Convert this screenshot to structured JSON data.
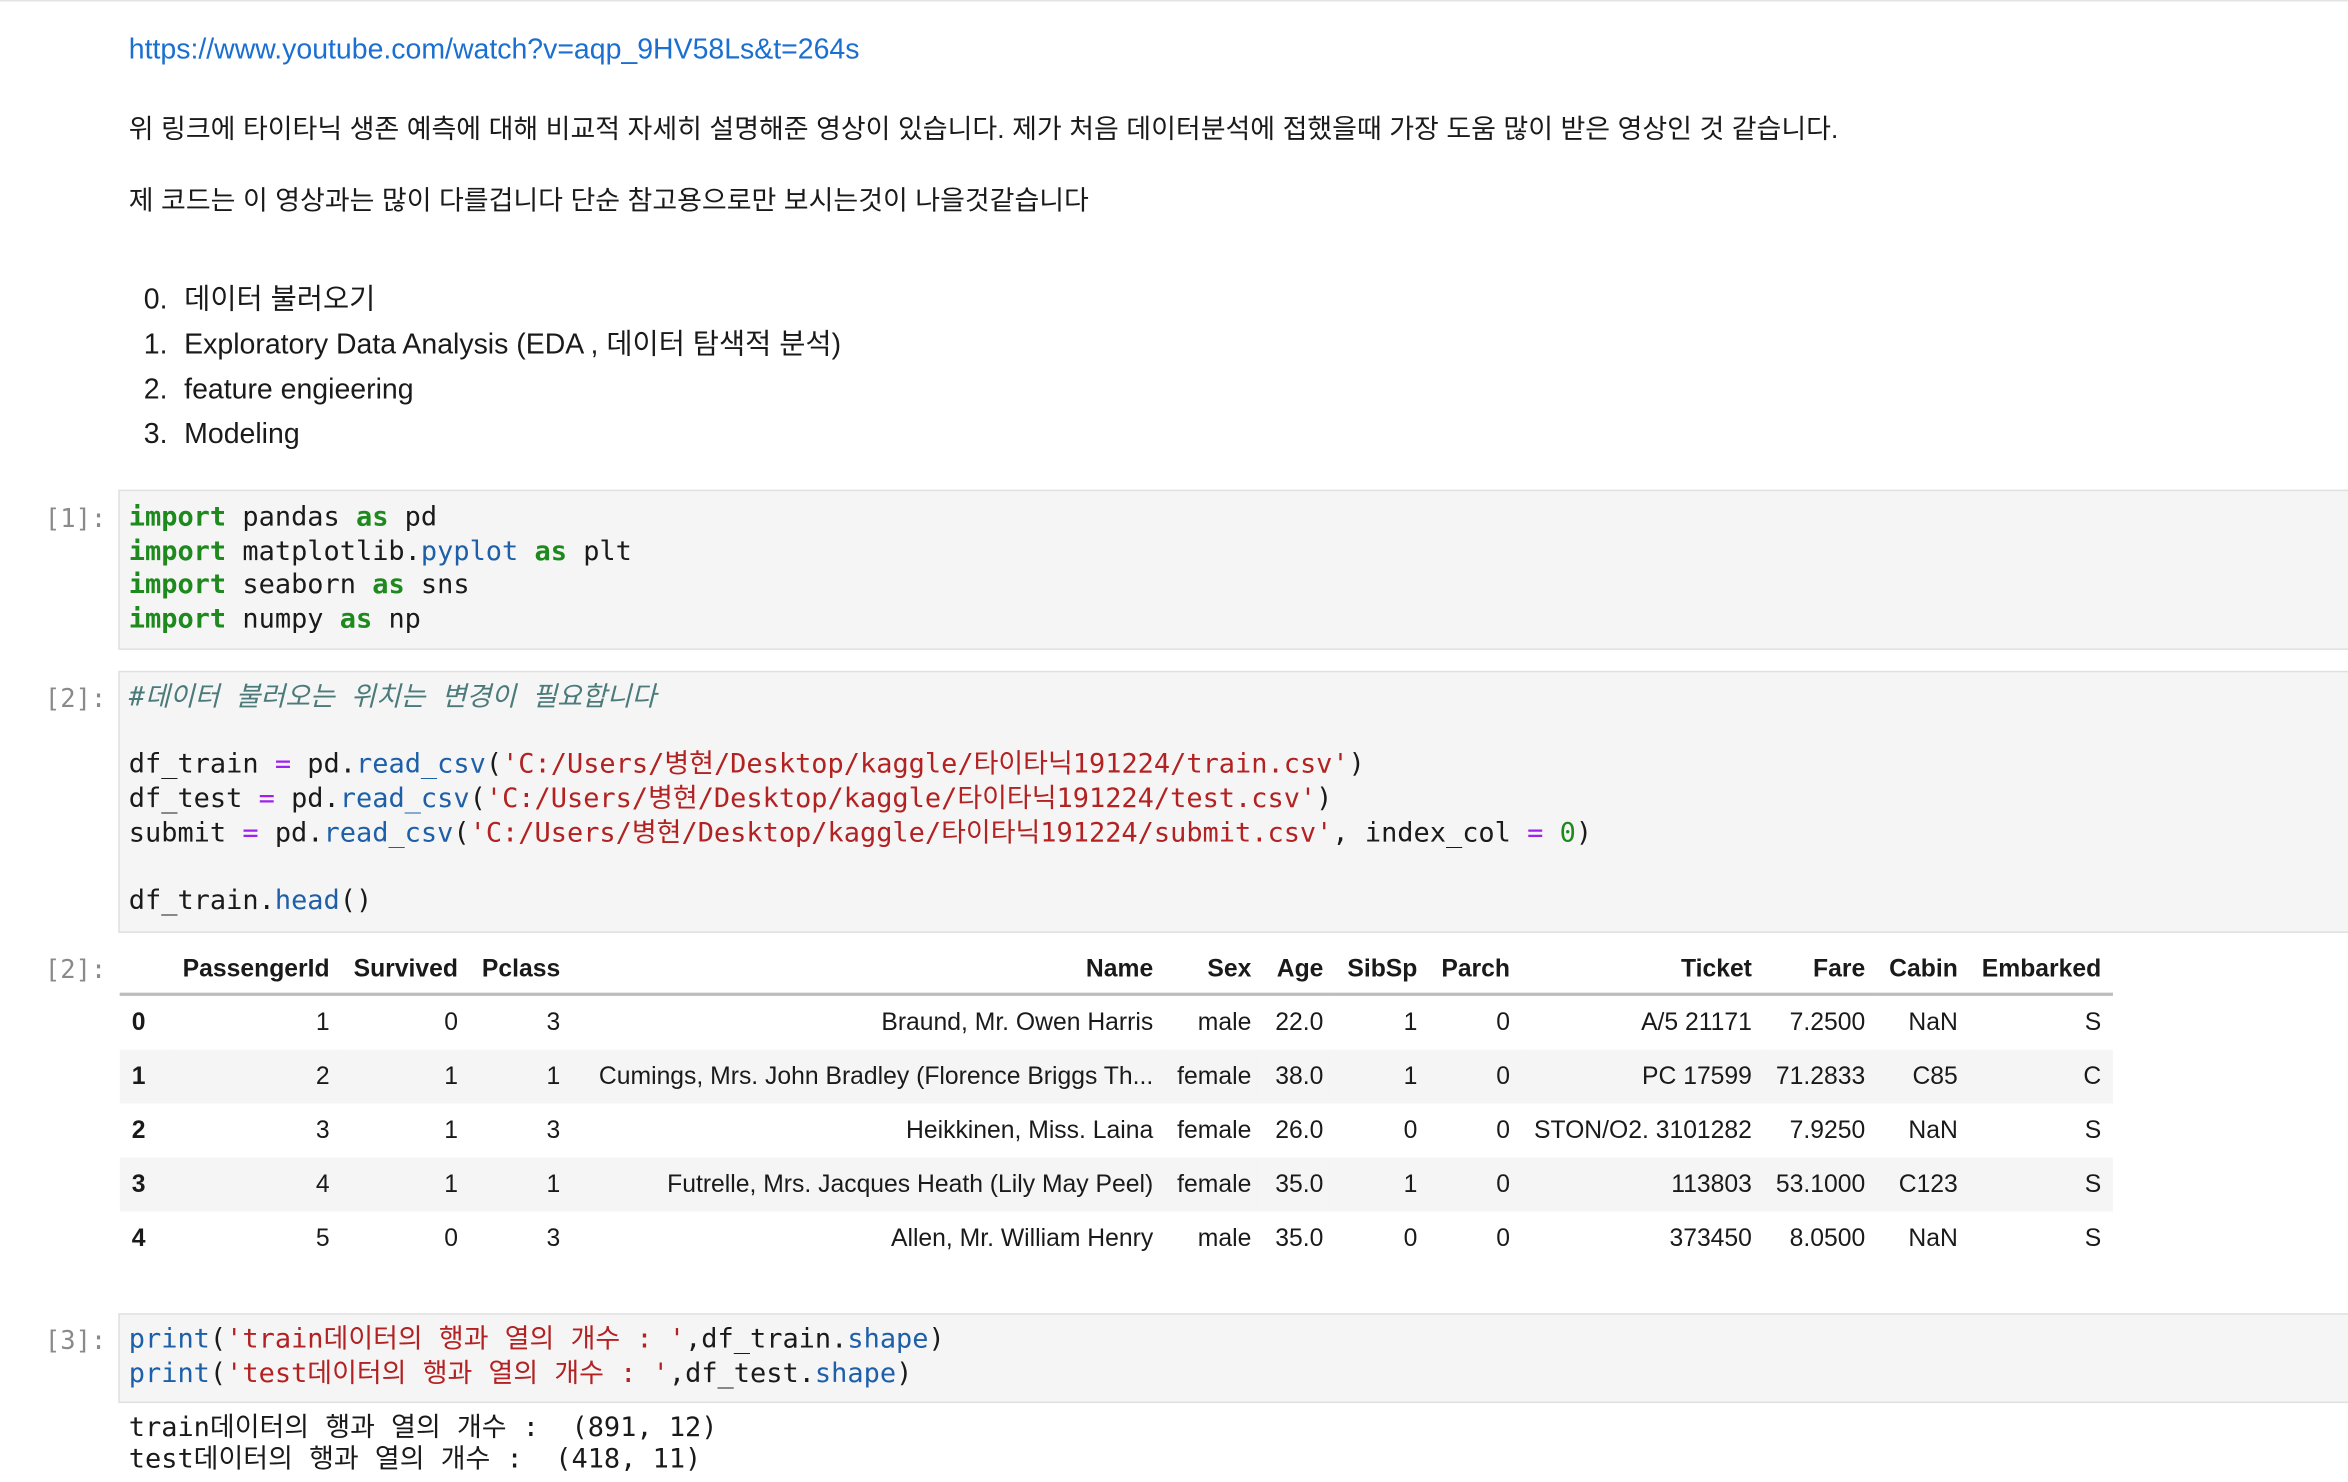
{
  "markdown": {
    "link": "https://www.youtube.com/watch?v=aqp_9HV58Ls&t=264s",
    "para1": "위 링크에 타이타닉 생존 예측에 대해 비교적 자세히 설명해준 영상이 있습니다. 제가 처음 데이터분석에 접했을때 가장 도움 많이 받은 영상인 것 같습니다.",
    "para2": "제 코드는 이 영상과는 많이 다를겁니다 단순 참고용으로만 보시는것이 나을것같습니다",
    "list": [
      {
        "num": "0.",
        "text": "데이터 불러오기"
      },
      {
        "num": "1.",
        "text": "Exploratory Data Analysis (EDA , 데이터 탐색적 분석)"
      },
      {
        "num": "2.",
        "text": "feature engieering"
      },
      {
        "num": "3.",
        "text": "Modeling"
      }
    ]
  },
  "cells": {
    "c1": {
      "prompt": "[1]:",
      "tokens": {
        "import": "import",
        "as": "as",
        "pandas": " pandas ",
        "pd": " pd",
        "matplotlib": " matplotlib.",
        "pyplot": "pyplot",
        "plt": " plt",
        "seaborn": " seaborn ",
        "sns": " sns",
        "numpy": " numpy ",
        "np": " np"
      }
    },
    "c2": {
      "prompt": "[2]:",
      "out_prompt": "[2]:",
      "comment": "#데이터 불러오는 위치는 변경이 필요합니다",
      "train_var": "df_train ",
      "test_var": "df_test ",
      "submit_var": "submit ",
      "eq": "=",
      "pd_dot": " pd.",
      "read_csv": "read_csv",
      "open_paren": "(",
      "close_paren": ")",
      "train_path": "'C:/Users/병현/Desktop/kaggle/타이타닉191224/train.csv'",
      "test_path": "'C:/Users/병현/Desktop/kaggle/타이타닉191224/test.csv'",
      "submit_path": "'C:/Users/병현/Desktop/kaggle/타이타닉191224/submit.csv'",
      "index_col": ", index_col ",
      "zero": "0",
      "head_obj": "df_train.",
      "head_fn": "head",
      "head_parens": "()"
    },
    "c3": {
      "prompt": "[3]:",
      "print": "print",
      "train_str": "'train데이터의 행과 열의 개수 : '",
      "test_str": "'test데이터의 행과 열의 개수 : '",
      "train_obj": ",df_train.",
      "test_obj": ",df_test.",
      "shape": "shape",
      "output_line1": "train데이터의 행과 열의 개수 :  (891, 12)",
      "output_line2": "test데이터의 행과 열의 개수 :  (418, 11)"
    }
  },
  "dataframe": {
    "columns": [
      "",
      "PassengerId",
      "Survived",
      "Pclass",
      "Name",
      "Sex",
      "Age",
      "SibSp",
      "Parch",
      "Ticket",
      "Fare",
      "Cabin",
      "Embarked"
    ],
    "rows": [
      [
        "0",
        "1",
        "0",
        "3",
        "Braund, Mr. Owen Harris",
        "male",
        "22.0",
        "1",
        "0",
        "A/5 21171",
        "7.2500",
        "NaN",
        "S"
      ],
      [
        "1",
        "2",
        "1",
        "1",
        "Cumings, Mrs. John Bradley (Florence Briggs Th...",
        "female",
        "38.0",
        "1",
        "0",
        "PC 17599",
        "71.2833",
        "C85",
        "C"
      ],
      [
        "2",
        "3",
        "1",
        "3",
        "Heikkinen, Miss. Laina",
        "female",
        "26.0",
        "0",
        "0",
        "STON/O2. 3101282",
        "7.9250",
        "NaN",
        "S"
      ],
      [
        "3",
        "4",
        "1",
        "1",
        "Futrelle, Mrs. Jacques Heath (Lily May Peel)",
        "female",
        "35.0",
        "1",
        "0",
        "113803",
        "53.1000",
        "C123",
        "S"
      ],
      [
        "4",
        "5",
        "0",
        "3",
        "Allen, Mr. William Henry",
        "male",
        "35.0",
        "0",
        "0",
        "373450",
        "8.0500",
        "NaN",
        "S"
      ]
    ]
  },
  "colors": {
    "keyword": "#1e8a1e",
    "function": "#1d5fa8",
    "string": "#b22222",
    "operator": "#a020f0",
    "link": "#1a6fd1",
    "comment": "#4b7a7a"
  }
}
